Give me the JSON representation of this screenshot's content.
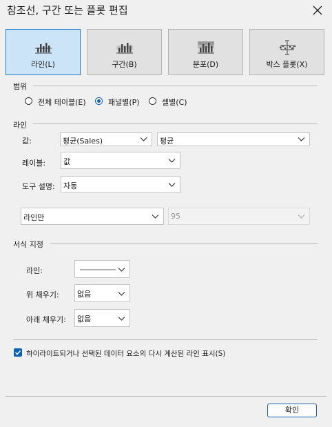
{
  "dialog": {
    "title": "참조선, 구간 또는 플롯 편집"
  },
  "tabs": [
    {
      "label": "라인(L)",
      "selected": true
    },
    {
      "label": "구간(B)",
      "selected": false
    },
    {
      "label": "분포(D)",
      "selected": false
    },
    {
      "label": "박스 플롯(X)",
      "selected": false
    }
  ],
  "scope": {
    "heading": "범위",
    "options": [
      {
        "label": "전체 테이블(E)",
        "selected": false
      },
      {
        "label": "패널별(P)",
        "selected": true
      },
      {
        "label": "셀별(C)",
        "selected": false
      }
    ]
  },
  "line": {
    "heading": "라인",
    "value_label": "값:",
    "value_field": "평균(Sales)",
    "aggregation": "평균",
    "label_label": "레이블:",
    "label_value": "값",
    "tooltip_label": "도구 설명:",
    "tooltip_value": "자동",
    "line_mode": "라인만",
    "confidence_value": "95"
  },
  "format": {
    "heading": "서식 지정",
    "line_label": "라인:",
    "fill_above_label": "위 채우기:",
    "fill_above_value": "없음",
    "fill_below_label": "아래 채우기:",
    "fill_below_value": "없음"
  },
  "recalc": {
    "label": "하이라이트되거나 선택된 데이터 요소의 다시 계산된 라인 표시(S)",
    "checked": true
  },
  "footer": {
    "ok_label": "확인"
  },
  "colors": {
    "accent": "#0a5fb4",
    "selected_tile": "#cce4f7"
  }
}
